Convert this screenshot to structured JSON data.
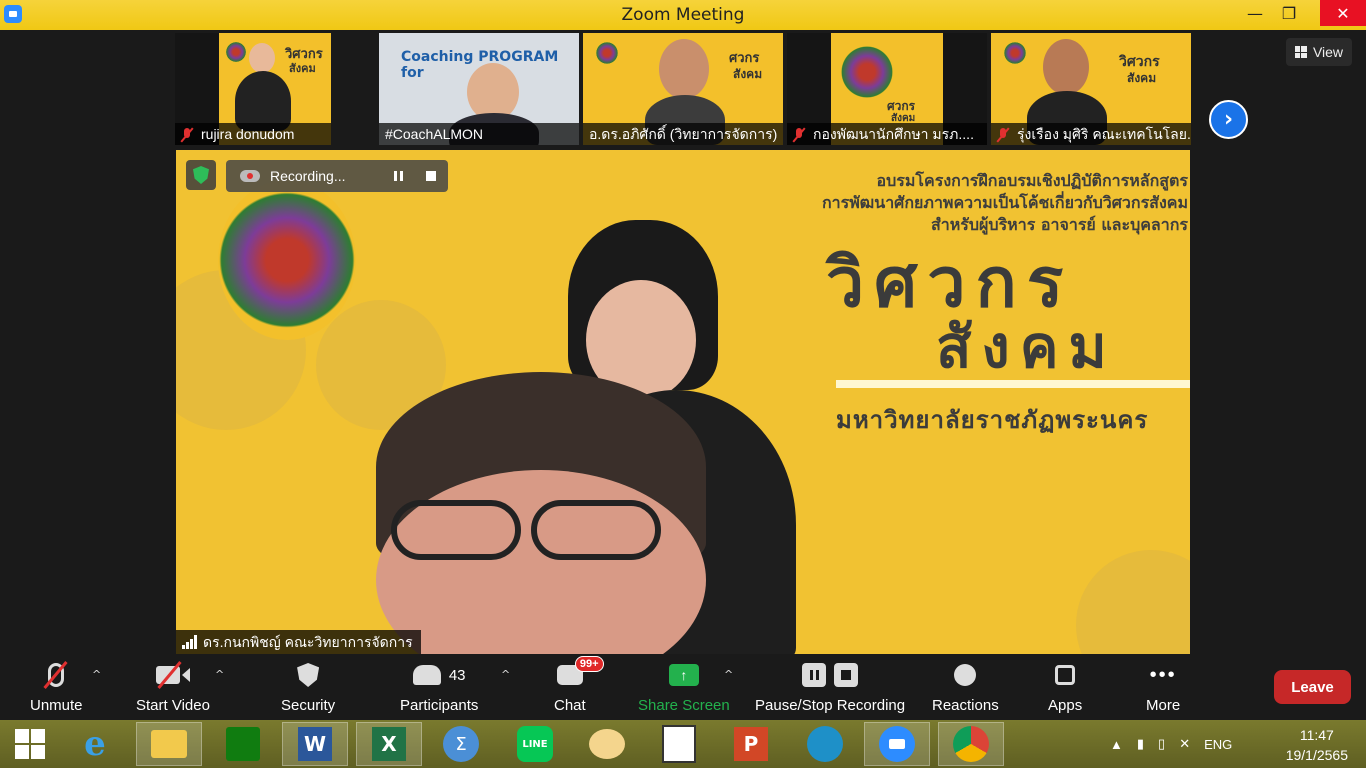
{
  "window": {
    "title": "Zoom Meeting",
    "minimize": "—",
    "maximize": "❐",
    "close": "✕"
  },
  "thumbnails": [
    {
      "name": "rujira donudom",
      "muted": true,
      "slide_word_1": "วิศวกร",
      "slide_word_2": "สังคม"
    },
    {
      "name": "#CoachALMON",
      "muted": false,
      "slide_text": "Coaching PROGRAM for"
    },
    {
      "name": "อ.ดร.อภิศักดิ์ (วิทยาการจัดการ)",
      "muted": false,
      "slide_word_1": "ศวกร",
      "slide_word_2": "สังคม"
    },
    {
      "name": "กองพัฒนานักศึกษา มรภ....",
      "muted": true,
      "slide_word_1": "ศวกร",
      "slide_word_2": "สังคม"
    },
    {
      "name": "รุ่งเรือง มุศิริ คณะเทคโนโลย...",
      "muted": true,
      "slide_word_1": "วิศวกร",
      "slide_word_2": "สังคม"
    }
  ],
  "view_button": "View",
  "main": {
    "recording_label": "Recording...",
    "heading_lines": [
      "อบรมโครงการฝึกอบรมเชิงปฏิบัติการหลักสูตร",
      "การพัฒนาศักยภาพความเป็นโค้ชเกี่ยวกับวิศวกรสังคม",
      "สำหรับผู้บริหาร อาจารย์ และบุคลากร"
    ],
    "big_word_1": "วิศวกร",
    "big_word_2": "สังคม",
    "university": "มหาวิทยาลัยราชภัฏพระนคร",
    "speaker_name": "ดร.กนกพิชญ์ คณะวิทยาการจัดการ"
  },
  "toolbar": {
    "unmute": "Unmute",
    "start_video": "Start Video",
    "security": "Security",
    "participants": "Participants",
    "participants_count": "43",
    "chat": "Chat",
    "chat_badge": "99+",
    "share_screen": "Share Screen",
    "pause_stop_recording": "Pause/Stop Recording",
    "reactions": "Reactions",
    "apps": "Apps",
    "more": "More",
    "leave": "Leave"
  },
  "taskbar": {
    "apps": [
      "start",
      "internet-explorer",
      "file-explorer",
      "store",
      "word",
      "excel",
      "math-input",
      "line",
      "paint",
      "lisrel",
      "powerpoint",
      "edge",
      "zoom",
      "chrome"
    ],
    "language": "ENG",
    "time": "11:47",
    "date": "19/1/2565"
  },
  "colors": {
    "zoom_blue": "#2d8cff",
    "leave_red": "#c62828",
    "share_green": "#23b14d",
    "slide_yellow": "#f1c232",
    "titlebar_yellow": "#f0c814"
  }
}
